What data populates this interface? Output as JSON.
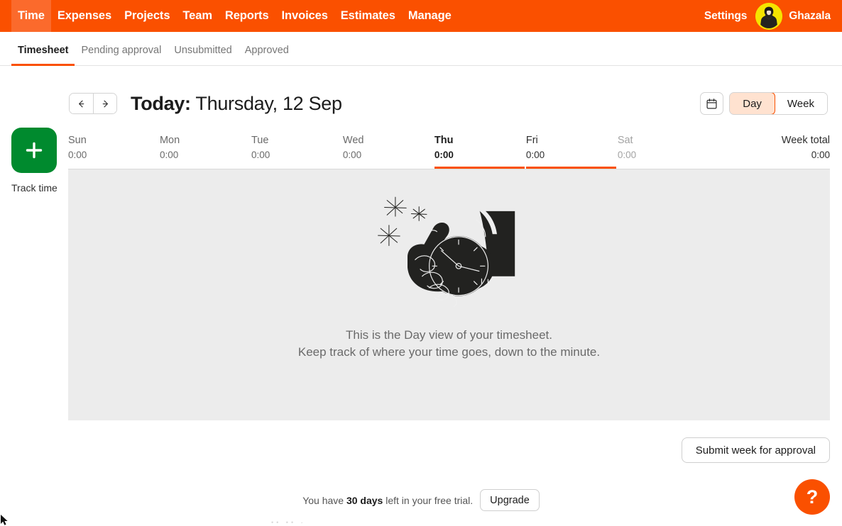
{
  "theme": {
    "brand_orange": "#fa5000",
    "nav_active_orange": "#fb6a2c",
    "day_toggle_bg": "#ffe2d0",
    "track_green": "#008a2e",
    "panel_gray": "#ececec",
    "avatar_yellow": "#f5e400"
  },
  "topnav": {
    "items": [
      {
        "label": "Time",
        "active": true
      },
      {
        "label": "Expenses",
        "active": false
      },
      {
        "label": "Projects",
        "active": false
      },
      {
        "label": "Team",
        "active": false
      },
      {
        "label": "Reports",
        "active": false
      },
      {
        "label": "Invoices",
        "active": false
      },
      {
        "label": "Estimates",
        "active": false
      },
      {
        "label": "Manage",
        "active": false
      }
    ],
    "settings_label": "Settings",
    "user_name": "Ghazala",
    "avatar_icon": "user-photo-avatar"
  },
  "subnav": {
    "tabs": [
      {
        "label": "Timesheet",
        "active": true
      },
      {
        "label": "Pending approval",
        "active": false
      },
      {
        "label": "Unsubmitted",
        "active": false
      },
      {
        "label": "Approved",
        "active": false
      }
    ]
  },
  "date_bar": {
    "prev_icon": "arrow-left-icon",
    "next_icon": "arrow-right-icon",
    "title_prefix": "Today:",
    "title_date": "Thursday, 12 Sep",
    "calendar_icon": "calendar-icon",
    "view_day_label": "Day",
    "view_week_label": "Week",
    "active_view": "Day"
  },
  "timesheet": {
    "columns": [
      {
        "name": "Sun",
        "total": "0:00",
        "state": "normal"
      },
      {
        "name": "Mon",
        "total": "0:00",
        "state": "normal"
      },
      {
        "name": "Tue",
        "total": "0:00",
        "state": "normal"
      },
      {
        "name": "Wed",
        "total": "0:00",
        "state": "normal"
      },
      {
        "name": "Thu",
        "total": "0:00",
        "state": "selected"
      },
      {
        "name": "Fri",
        "total": "0:00",
        "state": "semi"
      },
      {
        "name": "Sat",
        "total": "0:00",
        "state": "dim"
      }
    ],
    "week_total_label": "Week total",
    "week_total_value": "0:00",
    "empty_state": {
      "illustration": "hand-holding-stopwatch-illustration",
      "line1": "This is the Day view of your timesheet.",
      "line2": "Keep track of where your time goes, down to the minute."
    },
    "submit_button": "Submit week for approval"
  },
  "track_time": {
    "icon": "plus-icon",
    "label": "Track time"
  },
  "trial": {
    "text_before": "You have ",
    "days": "30 days",
    "text_after": " left in your free trial.",
    "upgrade_label": "Upgrade"
  },
  "help": {
    "icon": "question-mark-icon",
    "label": "?"
  },
  "footer_ghost": "•• •• -"
}
